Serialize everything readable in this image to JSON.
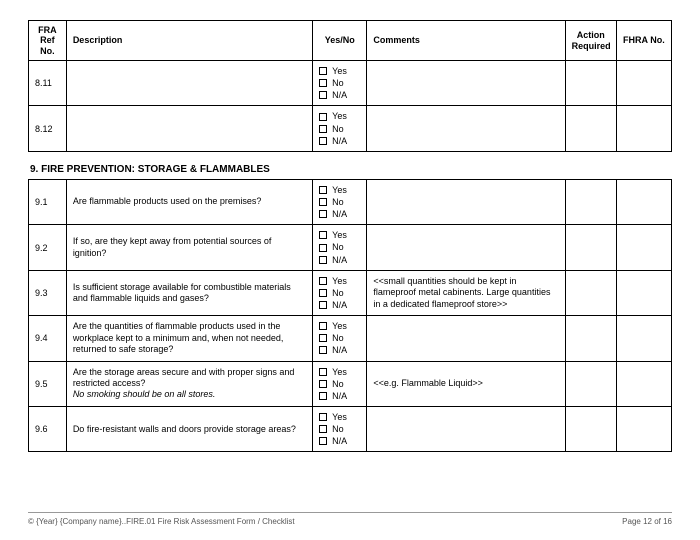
{
  "headers": {
    "ref": "FRA Ref No.",
    "description": "Description",
    "yesno": "Yes/No",
    "comments": "Comments",
    "action": "Action Required",
    "fhra": "FHRA No."
  },
  "yn": {
    "yes": "Yes",
    "no": "No",
    "na": "N/A"
  },
  "top_rows": [
    {
      "ref": "8.11",
      "description": "",
      "comments": ""
    },
    {
      "ref": "8.12",
      "description": "",
      "comments": ""
    }
  ],
  "section_title": "9. FIRE PREVENTION: STORAGE & FLAMMABLES",
  "rows": [
    {
      "ref": "9.1",
      "description": "Are flammable products used on the premises?",
      "comments": ""
    },
    {
      "ref": "9.2",
      "description": "If so, are they kept away from potential sources of ignition?",
      "comments": ""
    },
    {
      "ref": "9.3",
      "description": "Is sufficient storage available for combustible materials and flammable liquids and gases?",
      "comments": "<<small quantities should be kept in flameproof metal cabinents. Large quantities in a dedicated flameproof store>>"
    },
    {
      "ref": "9.4",
      "description": "Are the quantities of flammable products used in the workplace kept to a minimum and, when not needed, returned to safe storage?",
      "comments": ""
    },
    {
      "ref": "9.5",
      "description": "Are the storage areas secure and with proper signs and restricted access?",
      "description_italic": "No smoking should be on all stores.",
      "comments": "<<e.g. Flammable Liquid>>"
    },
    {
      "ref": "9.6",
      "description": "Do fire-resistant walls and doors provide storage areas?",
      "comments": ""
    }
  ],
  "footer": {
    "left": "© {Year} {Company name}..FIRE.01 Fire Risk Assessment Form /  Checklist",
    "right": "Page 12 of 16"
  }
}
